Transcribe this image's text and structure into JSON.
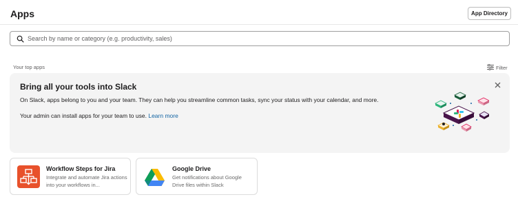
{
  "header": {
    "title": "Apps",
    "app_directory_label": "App Directory"
  },
  "search": {
    "placeholder": "Search by name or category (e.g. productivity, sales)",
    "value": ""
  },
  "top_apps": {
    "section_label": "Your top apps",
    "filter_label": "Filter"
  },
  "banner": {
    "title": "Bring all your tools into Slack",
    "body": "On Slack, apps belong to you and your team. They can help you streamline common tasks, sync your status with your calendar, and more.",
    "admin_note": "Your admin can install apps for your team to use.",
    "learn_more": "Learn more",
    "close_icon": "close-icon",
    "illustration": "app-tiles-illustration"
  },
  "apps": [
    {
      "name": "Workflow Steps for Jira",
      "description": "Integrate and automate Jira actions into your workflows in...",
      "icon": "workflow-jira-icon",
      "color": "#e8512b"
    },
    {
      "name": "Google Drive",
      "description": "Get notifications about Google Drive files within Slack",
      "icon": "google-drive-icon",
      "color": "#ffffff"
    }
  ],
  "colors": {
    "accent_link": "#1264a3",
    "banner_bg": "#f4f4f4",
    "text_primary": "#1d1c1d",
    "text_secondary": "#616061"
  }
}
